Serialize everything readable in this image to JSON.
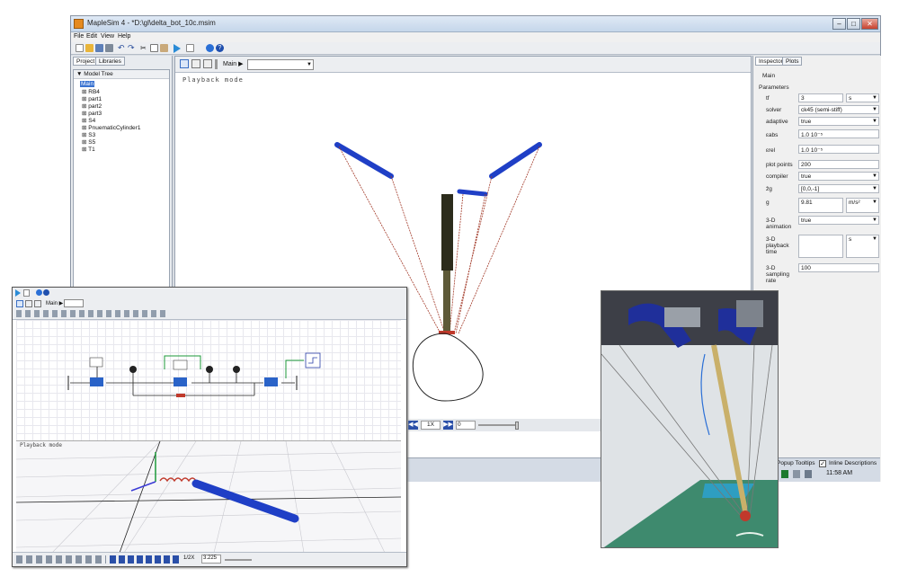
{
  "window": {
    "title": "MapleSim 4 - *D:\\gl\\delta_bot_10c.msim",
    "minimize": "–",
    "maximize": "□",
    "close": "✕"
  },
  "menu": [
    "File",
    "Edit",
    "View",
    "Help"
  ],
  "left_panel": {
    "tabs": [
      "Project",
      "Libraries"
    ],
    "tree_header": "Model Tree",
    "tree_items": [
      "Main",
      "RB4",
      "part1",
      "part2",
      "part3",
      "S4",
      "PnuematicCylinder1",
      "S3",
      "S5",
      "T1"
    ]
  },
  "center": {
    "breadcrumb": "Main",
    "playback_label": "Playback mode"
  },
  "playback": {
    "speed": "1X",
    "time": "0"
  },
  "inspector": {
    "tabs": [
      "Inspector",
      "Plots"
    ],
    "title": "Main",
    "section": "Parameters",
    "rows": [
      {
        "label": "tf",
        "value": "3",
        "unit": "s"
      },
      {
        "label": "solver",
        "value": "ck45 (semi-stiff)"
      },
      {
        "label": "adaptive",
        "value": "true"
      },
      {
        "label": "εabs",
        "value": "1.0 10⁻⁵"
      },
      {
        "label": "εrel",
        "value": "1.0 10⁻⁵"
      },
      {
        "label": "plot points",
        "value": "200"
      },
      {
        "label": "compiler",
        "value": "true"
      },
      {
        "label": "ẑg",
        "value": "[0,0,-1]"
      },
      {
        "label": "g",
        "value": "9.81",
        "unit": "m/s²"
      },
      {
        "label": "3-D animation",
        "value": "true"
      },
      {
        "label": "3-D playback time",
        "value": "",
        "unit": "s"
      },
      {
        "label": "3-D sampling rate",
        "value": "100"
      }
    ]
  },
  "taskbar": {
    "popup_tooltips": "Popup Tooltips",
    "inline_descriptions": "Inline Descriptions",
    "clock": "11:58 AM"
  },
  "inset": {
    "breadcrumb": "Main",
    "playback_label": "Playback mode",
    "speed": "1/2X",
    "time": "3.225"
  },
  "colors": {
    "accent_blue": "#1f3fc6",
    "rod": "#2c2c1c",
    "photo_mat": "#3e8a6e"
  }
}
